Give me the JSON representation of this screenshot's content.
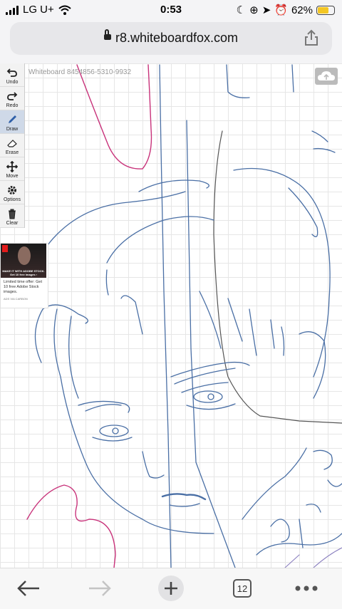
{
  "status": {
    "carrier": "LG U+",
    "time": "0:53",
    "battery": "62%",
    "battery_level": 0.62
  },
  "browser": {
    "url": "r8.whiteboardfox.com",
    "tab_count": "12"
  },
  "whiteboard": {
    "title": "Whiteboard 8454856-5310-9932"
  },
  "toolbar": {
    "undo": "Undo",
    "redo": "Redo",
    "draw": "Draw",
    "erase": "Erase",
    "move": "Move",
    "options": "Options",
    "clear": "Clear"
  },
  "ad": {
    "caption": "MAKE IT WITH ADOBE STOCK. Get 10 free images ›",
    "text": "Limited time offer: Get 10 free Adobe Stock images.",
    "via": "ADS VIA CARBON"
  },
  "colors": {
    "stroke_blue": "#4a6fa5",
    "stroke_pink": "#c8327a",
    "stroke_gray": "#555555",
    "active_tool": "#cfd9e8"
  }
}
